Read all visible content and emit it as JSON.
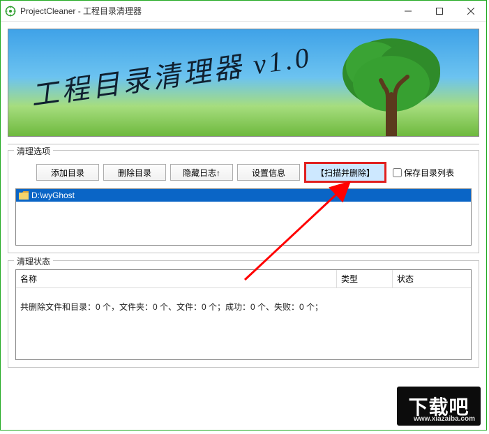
{
  "window": {
    "title": "ProjectCleaner - 工程目录清理器"
  },
  "banner": {
    "title": "工程目录清理器  v1.0"
  },
  "options": {
    "group_label": "清理选项",
    "add_dir": "添加目录",
    "del_dir": "删除目录",
    "hide_log": "隐藏日志↑",
    "settings": "设置信息",
    "scan_delete": "【扫描并删除】",
    "save_list_label": "保存目录列表",
    "save_list_checked": false,
    "directories": [
      {
        "path": "D:\\wyGhost"
      }
    ]
  },
  "status": {
    "group_label": "清理状态",
    "columns": {
      "name": "名称",
      "type": "类型",
      "state": "状态"
    },
    "summary": "共删除文件和目录：0 个，文件夹：0 个、文件：0 个；成功：0 个、失败：0 个；",
    "rows": []
  },
  "watermark": {
    "text": "下载吧",
    "url": "www.xiazaiba.com"
  }
}
